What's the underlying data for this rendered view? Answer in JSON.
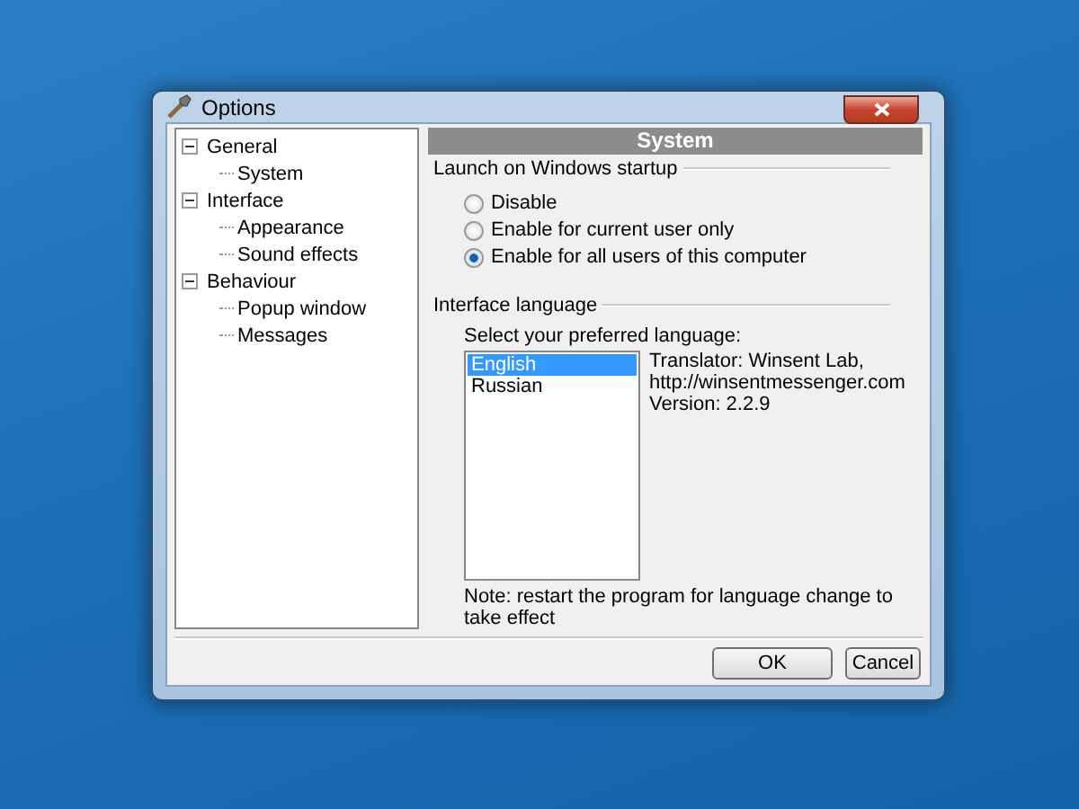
{
  "window": {
    "title": "Options"
  },
  "tree": [
    {
      "label": "General",
      "expanded": true,
      "children": [
        {
          "label": "System"
        }
      ]
    },
    {
      "label": "Interface",
      "expanded": true,
      "children": [
        {
          "label": "Appearance"
        },
        {
          "label": "Sound effects"
        }
      ]
    },
    {
      "label": "Behaviour",
      "expanded": true,
      "children": [
        {
          "label": "Popup window"
        },
        {
          "label": "Messages"
        }
      ]
    }
  ],
  "panel_title": "System",
  "startup": {
    "label": "Launch on Windows startup",
    "options": [
      {
        "label": "Disable",
        "selected": false
      },
      {
        "label": "Enable for current user only",
        "selected": false
      },
      {
        "label": "Enable for all users of this computer",
        "selected": true
      }
    ]
  },
  "language": {
    "label": "Interface language",
    "prompt": "Select your preferred language:",
    "items": [
      {
        "label": "English",
        "selected": true
      },
      {
        "label": "Russian",
        "selected": false
      }
    ],
    "info": [
      "Translator: Winsent Lab,",
      "http://winsentmessenger.com",
      "Version: 2.2.9"
    ],
    "note": "Note: restart the program for language change to take effect"
  },
  "buttons": [
    "OK",
    "Cancel"
  ]
}
